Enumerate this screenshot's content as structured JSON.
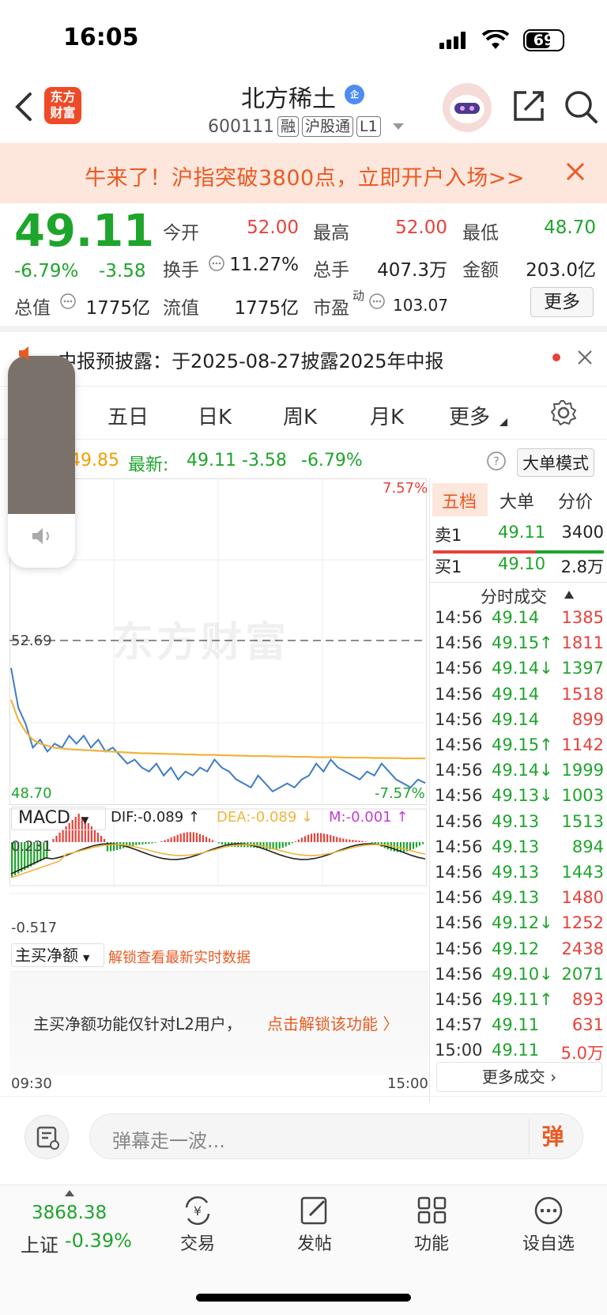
{
  "status_bar": {
    "time": "16:05",
    "battery": "69"
  },
  "header": {
    "logo_text": "东方财富",
    "stock_name": "北方稀土",
    "verified_badge": "企",
    "stock_code": "600111",
    "tags": [
      "融",
      "沪股通",
      "L1"
    ]
  },
  "banner": {
    "text": "牛来了！沪指突破3800点，立即开户入场>>"
  },
  "quote": {
    "price": "49.11",
    "change_pct": "-6.79%",
    "change": "-3.58",
    "fields": {
      "open_label": "今开",
      "open": "52.00",
      "high_label": "最高",
      "high": "52.00",
      "low_label": "最低",
      "low": "48.70",
      "turnover_label": "换手",
      "turnover": "11.27%",
      "volume_label": "总手",
      "volume": "407.3万",
      "amount_label": "金额",
      "amount": "203.0亿",
      "mktcap_label": "总值",
      "mktcap": "1775亿",
      "float_label": "流值",
      "float_cap": "1775亿",
      "pe_label": "市盈",
      "pe_sup": "动",
      "pe": "103.07"
    },
    "more_button": "更多"
  },
  "notice": {
    "text": "中报预披露：于2025-08-27披露2025年中报"
  },
  "tabs": [
    "五日",
    "日K",
    "周K",
    "月K",
    "更多"
  ],
  "summary": {
    "avg_value": "49.85",
    "latest_label": "最新:",
    "latest": "49.11",
    "change": "-3.58",
    "change_pct": "-6.79%",
    "big_order_mode": "大单模式"
  },
  "chart_data": {
    "type": "line",
    "ylim": [
      48.7,
      52.69
    ],
    "top_pct": "7.57%",
    "bottom_pct": "-7.57%",
    "prev_close_label": "52.69",
    "low_label": "48.70",
    "x_start": "09:30",
    "x_end": "15:00",
    "watermark": "东方财富",
    "series": [
      {
        "color": "#3e7cc9",
        "values": [
          52.0,
          51.0,
          50.6,
          50.0,
          50.2,
          49.9,
          50.1,
          50.0,
          50.3,
          50.1,
          50.3,
          50.0,
          50.2,
          49.9,
          50.0,
          49.8,
          49.6,
          49.7,
          49.5,
          49.4,
          49.6,
          49.3,
          49.5,
          49.2,
          49.4,
          49.3,
          49.5,
          49.4,
          49.7,
          49.5,
          49.4,
          49.2,
          49.1,
          49.0,
          49.3,
          49.1,
          48.9,
          49.0,
          49.1,
          49.0,
          49.2,
          49.3,
          49.6,
          49.4,
          49.7,
          49.5,
          49.4,
          49.3,
          49.2,
          49.4,
          49.3,
          49.6,
          49.4,
          49.2,
          49.1,
          49.0,
          49.2,
          49.11
        ]
      },
      {
        "color": "#f0b43c",
        "values": [
          51.2,
          50.7,
          50.4,
          50.2,
          50.1,
          50.05,
          50.0,
          49.98,
          49.96,
          49.95,
          49.94,
          49.93,
          49.92,
          49.91,
          49.9,
          49.89,
          49.88,
          49.87,
          49.86,
          49.86,
          49.85,
          49.85,
          49.84,
          49.84,
          49.83,
          49.83,
          49.82,
          49.82,
          49.82,
          49.81,
          49.81,
          49.8,
          49.8,
          49.79,
          49.79,
          49.79,
          49.78,
          49.78,
          49.78,
          49.77,
          49.77,
          49.77,
          49.76,
          49.76,
          49.76,
          49.76,
          49.75,
          49.75,
          49.75,
          49.75,
          49.74,
          49.74,
          49.74,
          49.74,
          49.73,
          49.73,
          49.73,
          49.73
        ]
      }
    ]
  },
  "macd": {
    "label": "MACD",
    "dif": "DIF:-0.089 ↑",
    "dea": "DEA:-0.089 ↓",
    "m": "M:-0.001 ↑",
    "top": "0.231",
    "bottom": "-0.517"
  },
  "netbuy": {
    "label": "主买净额",
    "unlock_link": "解锁查看最新实时数据",
    "panel_text": "主买净额功能仅针对L2用户，",
    "panel_link": "点击解锁该功能 〉"
  },
  "right_panel": {
    "tabs": [
      "五档",
      "大单",
      "分价"
    ],
    "sell1": {
      "label": "卖1",
      "price": "49.11",
      "vol": "3400"
    },
    "buy1": {
      "label": "买1",
      "price": "49.10",
      "vol": "2.8万"
    },
    "ticks_header": "分时成交",
    "ticks": [
      {
        "t": "14:56",
        "p": "49.14",
        "v": "1385",
        "pc": "green",
        "vc": "red"
      },
      {
        "t": "14:56",
        "p": "49.15↑",
        "v": "1811",
        "pc": "green",
        "vc": "red"
      },
      {
        "t": "14:56",
        "p": "49.14↓",
        "v": "1397",
        "pc": "green",
        "vc": "green"
      },
      {
        "t": "14:56",
        "p": "49.14",
        "v": "1518",
        "pc": "green",
        "vc": "red"
      },
      {
        "t": "14:56",
        "p": "49.14",
        "v": "899",
        "pc": "green",
        "vc": "red"
      },
      {
        "t": "14:56",
        "p": "49.15↑",
        "v": "1142",
        "pc": "green",
        "vc": "red"
      },
      {
        "t": "14:56",
        "p": "49.14↓",
        "v": "1999",
        "pc": "green",
        "vc": "green"
      },
      {
        "t": "14:56",
        "p": "49.13↓",
        "v": "1003",
        "pc": "green",
        "vc": "green"
      },
      {
        "t": "14:56",
        "p": "49.13",
        "v": "1513",
        "pc": "green",
        "vc": "green"
      },
      {
        "t": "14:56",
        "p": "49.13",
        "v": "894",
        "pc": "green",
        "vc": "green"
      },
      {
        "t": "14:56",
        "p": "49.13",
        "v": "1443",
        "pc": "green",
        "vc": "green"
      },
      {
        "t": "14:56",
        "p": "49.13",
        "v": "1480",
        "pc": "green",
        "vc": "red"
      },
      {
        "t": "14:56",
        "p": "49.12↓",
        "v": "1252",
        "pc": "green",
        "vc": "red"
      },
      {
        "t": "14:56",
        "p": "49.12",
        "v": "2438",
        "pc": "green",
        "vc": "red"
      },
      {
        "t": "14:56",
        "p": "49.10↓",
        "v": "2071",
        "pc": "green",
        "vc": "green"
      },
      {
        "t": "14:56",
        "p": "49.11↑",
        "v": "893",
        "pc": "green",
        "vc": "red"
      },
      {
        "t": "14:57",
        "p": "49.11",
        "v": "631",
        "pc": "green",
        "vc": "red"
      },
      {
        "t": "15:00",
        "p": "49.11",
        "v": "5.0万",
        "pc": "green",
        "vc": "red"
      }
    ],
    "more_ticks": "更多成交 ›"
  },
  "comment": {
    "placeholder": "弹幕走一波...",
    "danmu": "弹"
  },
  "nav": {
    "index_value": "3868.38",
    "index_name": "上证",
    "index_pct": "-0.39%",
    "items": [
      "交易",
      "发帖",
      "功能",
      "设自选"
    ]
  },
  "colors": {
    "up": "#e8413a",
    "down": "#1ea52b",
    "accent": "#ea5a23",
    "line": "#3e7cc9",
    "avg": "#f0b43c"
  }
}
